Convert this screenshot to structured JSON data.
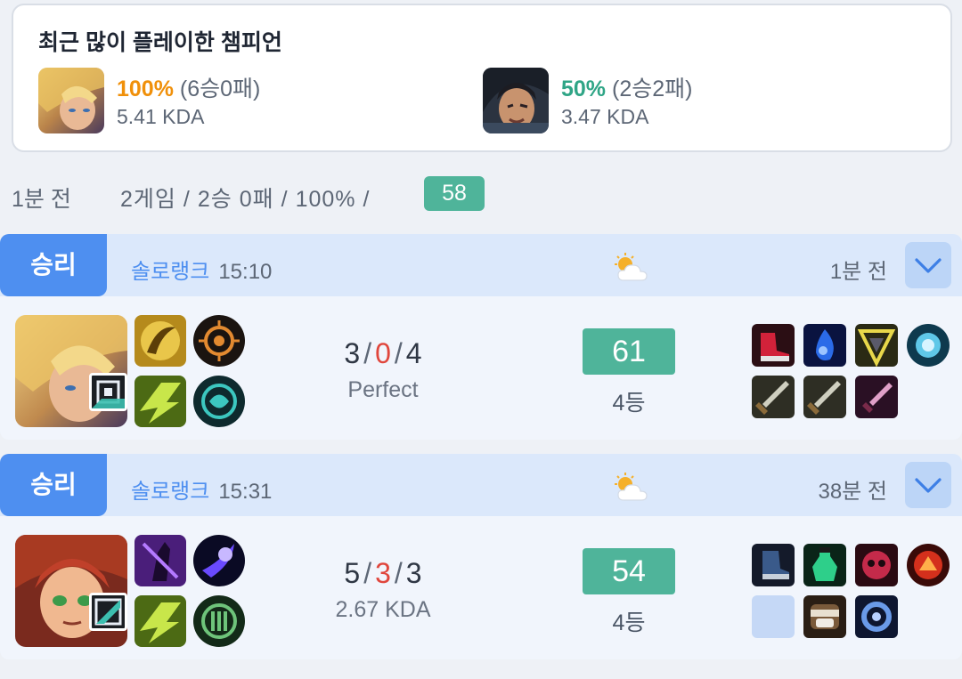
{
  "recent": {
    "title": "최근 많이 플레이한 챔피언",
    "champions": [
      {
        "rate": "100%",
        "record": "(6승0패)",
        "kda": "5.41 KDA",
        "rate_color": "#f0900a",
        "portrait": "ezreal-portrait"
      },
      {
        "rate": "50%",
        "record": "(2승2패)",
        "kda": "3.47 KDA",
        "rate_color": "#2fa586",
        "portrait": "sylas-portrait"
      }
    ]
  },
  "summary": {
    "time": "1분 전",
    "games": "2게임",
    "record": "2승 0패",
    "winrate": "100%",
    "sep": "/",
    "score": "58"
  },
  "matches": [
    {
      "result": "승리",
      "queue": "솔로랭크",
      "duration": "15:10",
      "weather": "partly-cloudy-icon",
      "ago": "1분 전",
      "champion": "ezreal-portrait",
      "kills": "3",
      "deaths": "0",
      "assists": "4",
      "kda_sub": "Perfect",
      "score": "61",
      "rank": "4등"
    },
    {
      "result": "승리",
      "queue": "솔로랭크",
      "duration": "15:31",
      "weather": "partly-cloudy-icon",
      "ago": "38분 전",
      "champion": "annie-portrait",
      "kills": "5",
      "deaths": "3",
      "assists": "3",
      "kda_sub": "2.67 KDA",
      "score": "54",
      "rank": "4등"
    }
  ],
  "colors": {
    "win": "#4e8ff0",
    "score": "#4fb49a",
    "death": "#e0463c"
  }
}
